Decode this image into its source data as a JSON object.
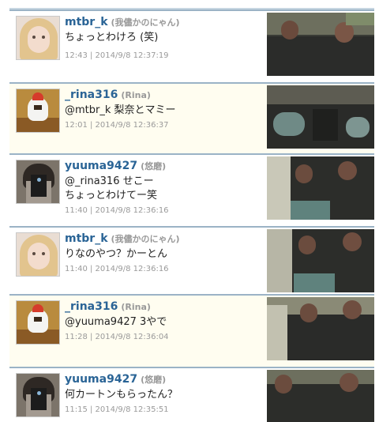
{
  "tweets": [
    {
      "screen_name": "mtbr_k",
      "display_name": "(我儘かのにゃん)",
      "text": "ちょっとわけろ (笑)",
      "meta": "12:43 | 2014/9/8 12:37:19",
      "avatar": "blonde-girl-avatar",
      "highlight": false
    },
    {
      "screen_name": "_rina316",
      "display_name": "(Rina)",
      "text": "@mtbr_k 梨奈とマミー",
      "meta": "12:01 | 2014/9/8 12:36:37",
      "avatar": "cartoon-avatar",
      "highlight": true
    },
    {
      "screen_name": "yuuma9427",
      "display_name": "(悠磨)",
      "text": "@_rina316 せこー\nちょっとわけてー笑",
      "meta": "11:40 | 2014/9/8 12:36:16",
      "avatar": "phone-selfie-avatar",
      "highlight": false
    },
    {
      "screen_name": "mtbr_k",
      "display_name": "(我儘かのにゃん)",
      "text": "りなのやつ？かーとん",
      "meta": "11:40 | 2014/9/8 12:36:16",
      "avatar": "blonde-girl-avatar",
      "highlight": false
    },
    {
      "screen_name": "_rina316",
      "display_name": "(Rina)",
      "text": "@yuuma9427 3やで",
      "meta": "11:28 | 2014/9/8 12:36:04",
      "avatar": "cartoon-avatar",
      "highlight": true
    },
    {
      "screen_name": "yuuma9427",
      "display_name": "(悠磨)",
      "text": "何カートンもらったん？",
      "meta": "11:15 | 2014/9/8 12:35:51",
      "avatar": "phone-selfie-avatar",
      "highlight": false
    }
  ]
}
